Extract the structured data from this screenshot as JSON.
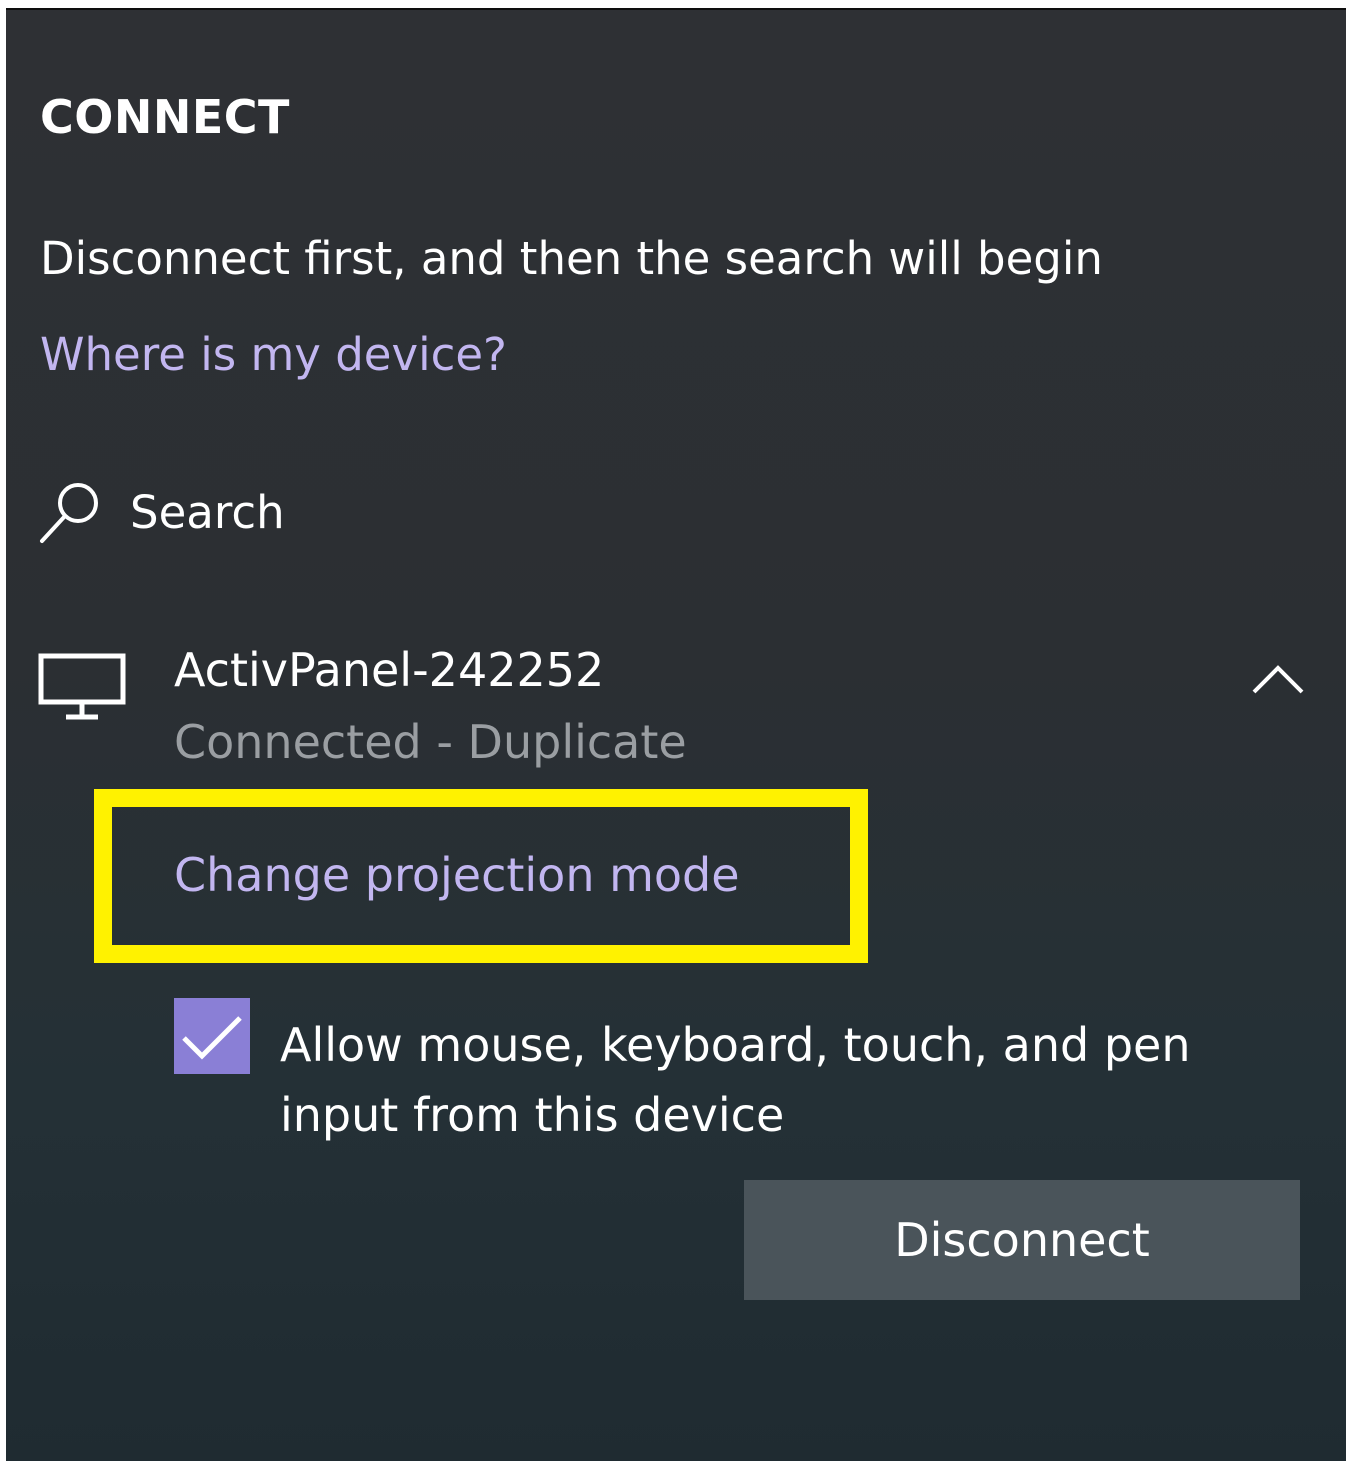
{
  "panel": {
    "title": "CONNECT",
    "info_text": "Disconnect first, and then the search will begin",
    "help_link": "Where is my device?"
  },
  "search": {
    "label": "Search",
    "icon": "search-icon"
  },
  "device": {
    "icon": "monitor-icon",
    "name": "ActivPanel-242252",
    "status": "Connected - Duplicate",
    "expanded": true,
    "projection_link": "Change projection mode",
    "input_checkbox": {
      "checked": true,
      "label_line1": "Allow mouse, keyboard, touch, and pen",
      "label_line2": "input from this device"
    },
    "disconnect_label": "Disconnect"
  },
  "colors": {
    "accent_link": "#c2b6f0",
    "checkbox": "#8a7fd6",
    "highlight": "#fff200",
    "button_bg": "#4a545a"
  }
}
